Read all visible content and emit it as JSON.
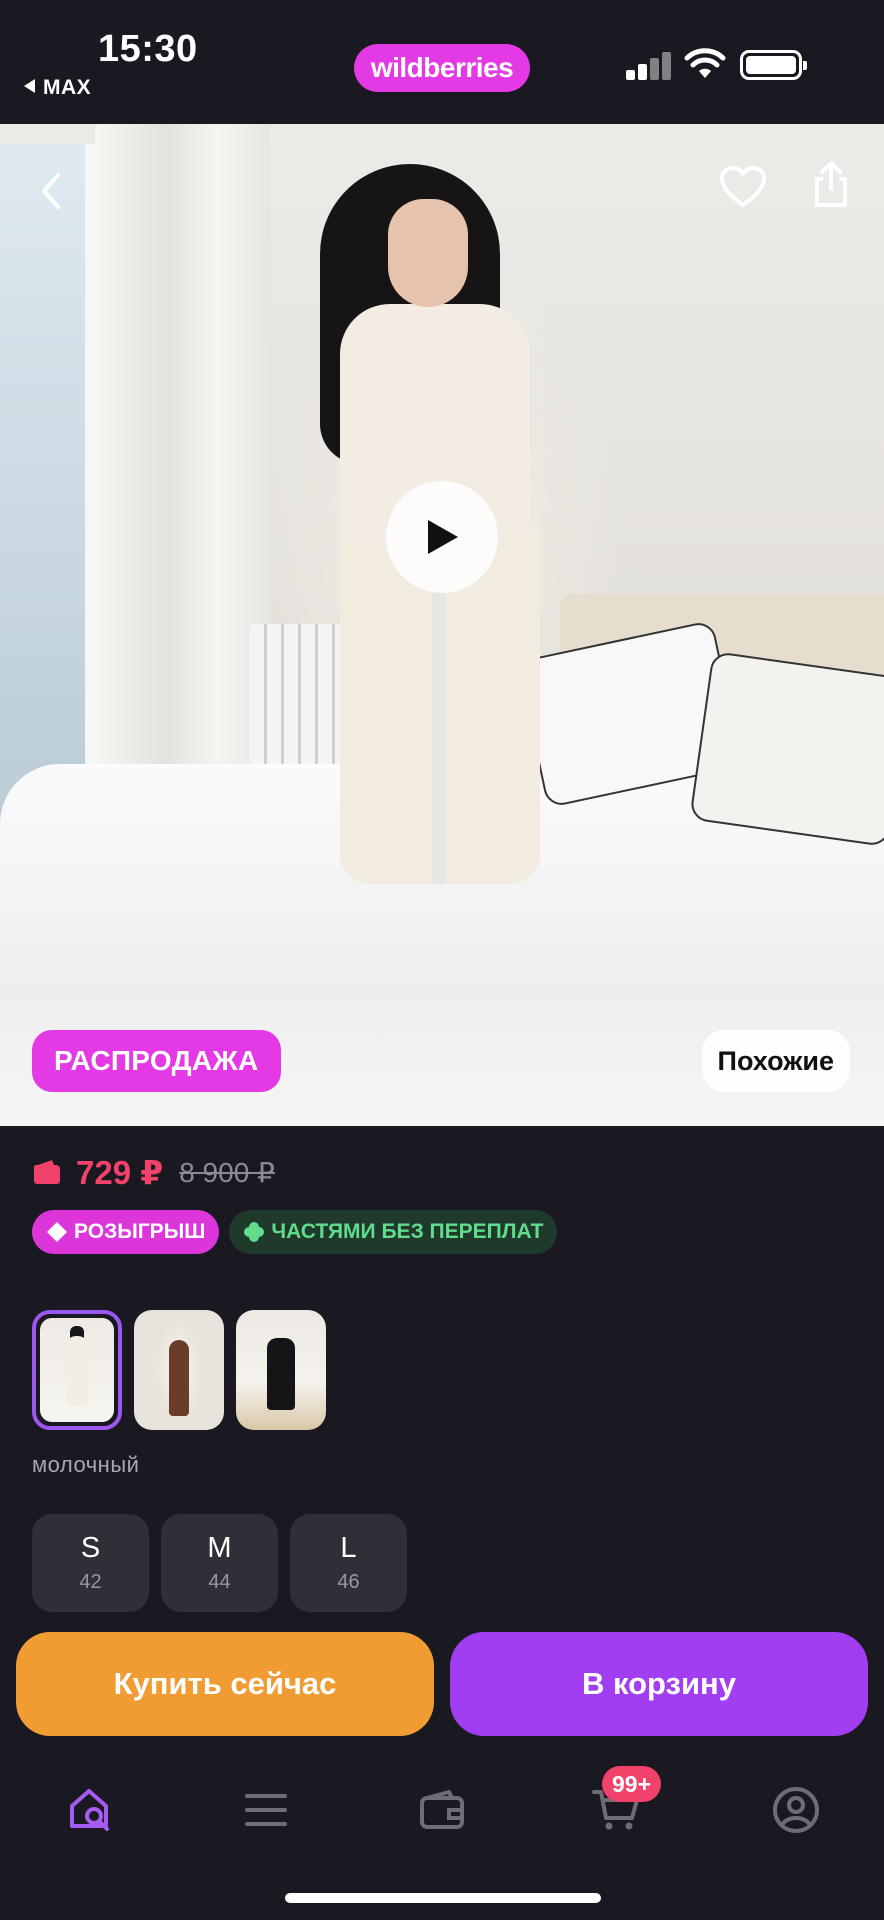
{
  "status_bar": {
    "time": "15:30",
    "back_app": "MAX",
    "brand": "wildberries",
    "icons": [
      "cellular-signal-icon",
      "wifi-icon",
      "battery-icon"
    ]
  },
  "hero": {
    "icons": [
      "back-chevron-icon",
      "heart-icon",
      "share-icon",
      "play-icon"
    ],
    "sale_badge": "РАСПРОДАЖА",
    "similar_button": "Похожие"
  },
  "price": {
    "current": "729 ₽",
    "old": "8 900 ₽",
    "current_color": "#f0426b"
  },
  "chips": {
    "raffle": "РОЗЫГРЫШ",
    "installments": "ЧАСТЯМИ БЕЗ ПЕРЕПЛАТ"
  },
  "colors": {
    "selected_label": "молочный",
    "selected_index": 0
  },
  "sizes": [
    {
      "letter": "S",
      "number": "42"
    },
    {
      "letter": "M",
      "number": "44"
    },
    {
      "letter": "L",
      "number": "46"
    }
  ],
  "actions": {
    "buy_now": "Купить сейчас",
    "add_to_cart": "В корзину",
    "buy_color": "#f19b33",
    "cart_color": "#a23ef2"
  },
  "tabbar": {
    "icons": [
      "home-search-icon",
      "menu-icon",
      "wallet-icon",
      "cart-icon",
      "profile-icon"
    ],
    "cart_badge": "99+"
  }
}
